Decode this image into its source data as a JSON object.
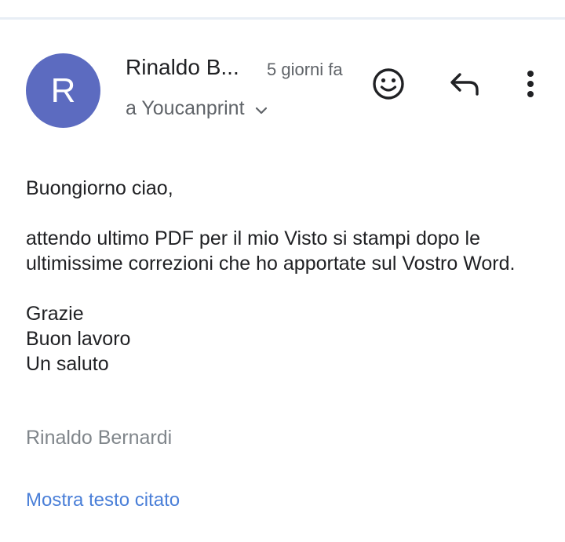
{
  "header": {
    "avatar_initial": "R",
    "avatar_color": "#5c6bc0",
    "sender_name": "Rinaldo B...",
    "timestamp": "5 giorni fa",
    "recipient": "a Youcanprint",
    "icons": [
      "smiley-icon",
      "reply-icon",
      "more-vert-icon",
      "chevron-down-icon"
    ]
  },
  "body": {
    "greeting": "Buongiorno ciao,",
    "paragraph": "attendo ultimo PDF per il mio Visto si stampi dopo le ultimissime correzioni che ho apportate sul Vostro Word.",
    "closing_lines": [
      "Grazie",
      "Buon lavoro",
      "Un saluto"
    ]
  },
  "signature": "Rinaldo Bernardi",
  "quoted_link": "Mostra testo citato",
  "colors": {
    "link": "#4a7fd8",
    "muted": "#5f6368"
  }
}
